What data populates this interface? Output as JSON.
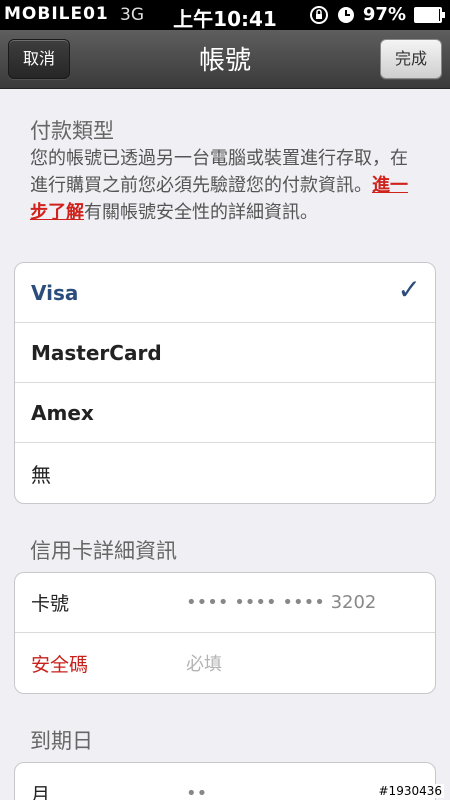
{
  "status_bar": {
    "watermark": "MOBILE01",
    "carrier": "3G",
    "time": "上午10:41",
    "battery_percent": "97%",
    "battery_level": 0.97
  },
  "nav": {
    "cancel_label": "取消",
    "title": "帳號",
    "done_label": "完成"
  },
  "payment_type": {
    "title": "付款類型",
    "desc_before": "您的帳號已透過另一台電腦或裝置進行存取，在進行購買之前您必須先驗證您的付款資訊。",
    "link": "進一步了解",
    "desc_after": "有關帳號安全性的詳細資訊。",
    "options": [
      "Visa",
      "MasterCard",
      "Amex",
      "無"
    ],
    "selected": "Visa"
  },
  "card_details": {
    "title": "信用卡詳細資訊",
    "number_label": "卡號",
    "number_value": "•••• •••• •••• 3202",
    "security_label": "安全碼",
    "security_placeholder": "必填"
  },
  "expiry": {
    "title": "到期日",
    "month_label": "月",
    "month_value": "••"
  },
  "photo_tag": "#1930436"
}
